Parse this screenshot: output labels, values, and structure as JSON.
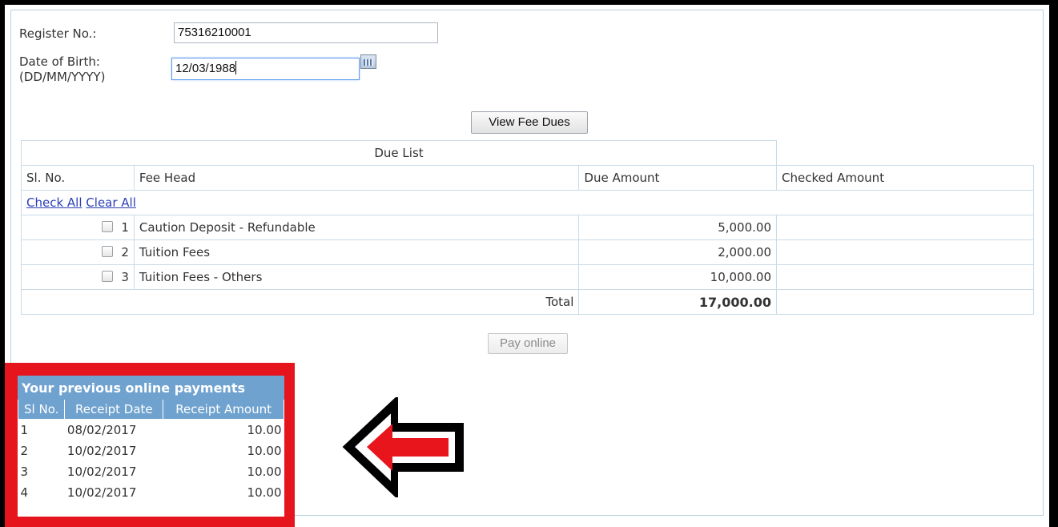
{
  "form": {
    "register_label": "Register No.:",
    "register_value": "75316210001",
    "dob_label_line1": "Date of Birth:",
    "dob_label_line2": "(DD/MM/YYYY)",
    "dob_value": "12/03/1988",
    "view_button": "View Fee Dues"
  },
  "due": {
    "title": "Due List",
    "headers": [
      "Sl. No.",
      "Fee Head",
      "Due Amount",
      "Checked Amount"
    ],
    "check_all": "Check All",
    "clear_all": "Clear All",
    "rows": [
      {
        "no": "1",
        "head": "Caution Deposit - Refundable",
        "amount": "5,000.00"
      },
      {
        "no": "2",
        "head": "Tuition Fees",
        "amount": "2,000.00"
      },
      {
        "no": "3",
        "head": "Tuition Fees - Others",
        "amount": "10,000.00"
      }
    ],
    "total_label": "Total",
    "total_value": "17,000.00",
    "pay_button": "Pay online"
  },
  "previous": {
    "title": "Your previous online payments",
    "headers": [
      "Sl No.",
      "Receipt Date",
      "Receipt Amount"
    ],
    "rows": [
      {
        "no": "1",
        "date": "08/02/2017",
        "amount": "10.00"
      },
      {
        "no": "2",
        "date": "10/02/2017",
        "amount": "10.00"
      },
      {
        "no": "3",
        "date": "10/02/2017",
        "amount": "10.00"
      },
      {
        "no": "4",
        "date": "10/02/2017",
        "amount": "10.00"
      }
    ]
  },
  "colors": {
    "highlight_box": "#e6151d",
    "arrow_fill": "#e8151c",
    "table_header": "#6fa2cf"
  }
}
